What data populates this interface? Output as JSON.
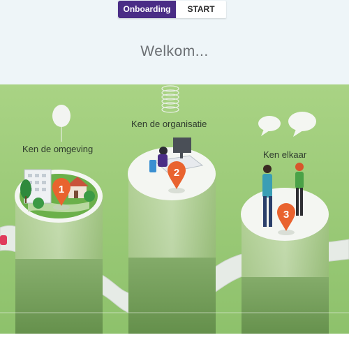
{
  "tabs": [
    {
      "label": "Onboarding",
      "active": true
    },
    {
      "label": "START",
      "active": false
    }
  ],
  "welcome_text": "Welkom...",
  "steps": [
    {
      "number": "1",
      "label": "Ken de omgeving"
    },
    {
      "number": "2",
      "label": "Ken de organisatie"
    },
    {
      "number": "3",
      "label": "Ken elkaar"
    }
  ],
  "colors": {
    "accent_purple": "#4a2d86",
    "pin_orange": "#e9632f",
    "grass_green": "#9ccb73",
    "header_bg": "#eef5f8"
  }
}
